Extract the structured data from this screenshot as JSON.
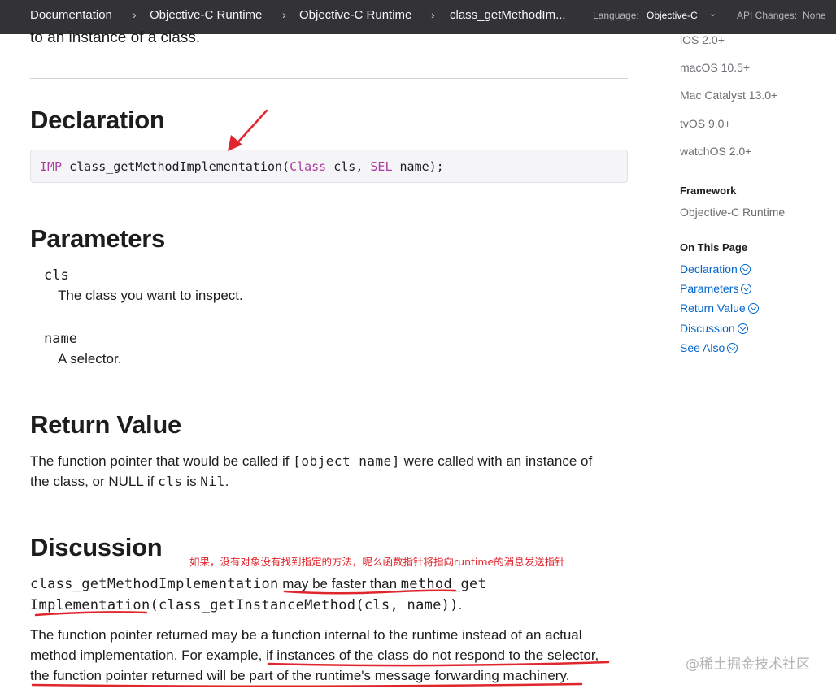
{
  "topbar": {
    "breadcrumbs": [
      "Documentation",
      "Objective-C Runtime",
      "Objective-C Runtime",
      "class_getMethodIm..."
    ],
    "language_label": "Language:",
    "language_value": "Objective-C",
    "api_changes_label": "API Changes:",
    "api_changes_value": "None"
  },
  "main": {
    "intro_tail": "to an instance of a class.",
    "declaration": {
      "heading": "Declaration",
      "code": {
        "return_type": "IMP",
        "fn": " class_getMethodImplementation(",
        "type1": "Class",
        "arg1": " cls, ",
        "type2": "SEL",
        "arg2": " name);"
      }
    },
    "parameters": {
      "heading": "Parameters",
      "items": [
        {
          "name": "cls",
          "desc": "The class you want to inspect."
        },
        {
          "name": "name",
          "desc": "A selector."
        }
      ]
    },
    "return_value": {
      "heading": "Return Value",
      "t1": "The function pointer that would be called if ",
      "c1": "[object name]",
      "t2": " were called with an instance of",
      "t3": "the class, or NULL if ",
      "c2": "cls",
      "t4": " is ",
      "c3": "Nil",
      "t5": "."
    },
    "discussion": {
      "heading": "Discussion",
      "line1_code1": "class_getMethodImplementation",
      "line1_text": " may be faster than ",
      "line1_code2": "method_get",
      "line2_code": "Implementation(class_getInstanceMethod(cls, name))",
      "line2_text": ".",
      "p2_line1": "The function pointer returned may be a function internal to the runtime instead of an actual",
      "p2_line2": "method implementation. For example, if instances of the class do not respond to the selector,",
      "p2_line3": "the function pointer returned will be part of the runtime's message forwarding machinery."
    }
  },
  "sidebar": {
    "availability": [
      "iOS 2.0+",
      "macOS 10.5+",
      "Mac Catalyst 13.0+",
      "tvOS 9.0+",
      "watchOS 2.0+"
    ],
    "framework_heading": "Framework",
    "framework_value": "Objective-C Runtime",
    "on_this_page_heading": "On This Page",
    "links": [
      "Declaration",
      "Parameters",
      "Return Value",
      "Discussion",
      "See Also"
    ]
  },
  "annotations": {
    "note": "如果，没有对象没有找到指定的方法，呢么函数指针将指向runtime的消息发送指针",
    "annotation_color": "#e0262d"
  },
  "watermark": "@稀土掘金技术社区"
}
